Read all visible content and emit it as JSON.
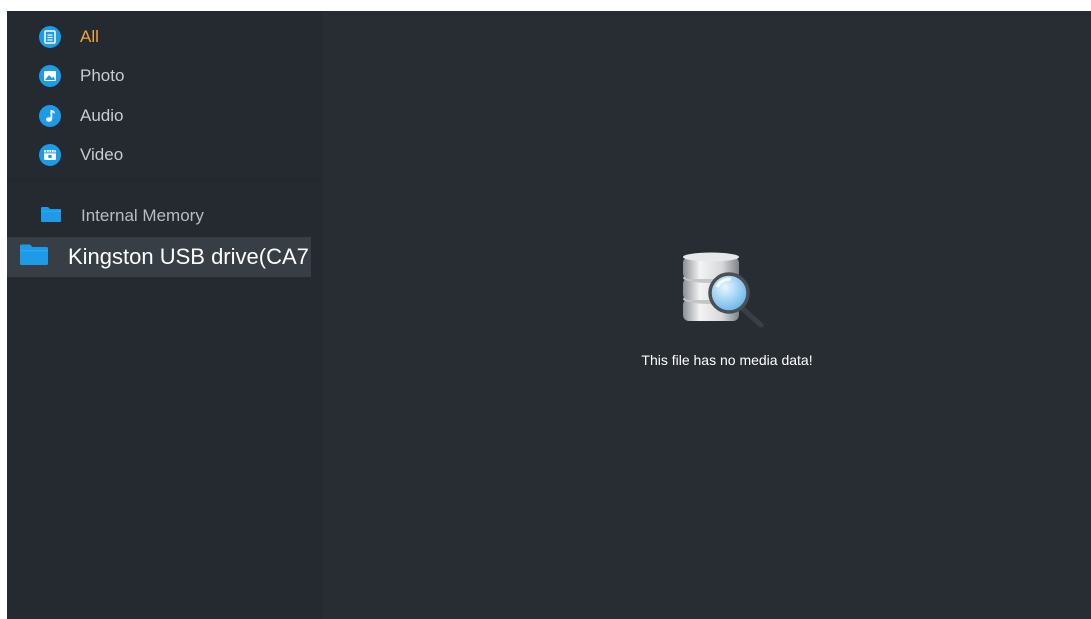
{
  "categories": [
    {
      "label": "All",
      "icon": "document-icon",
      "active": true
    },
    {
      "label": "Photo",
      "icon": "photo-icon",
      "active": false
    },
    {
      "label": "Audio",
      "icon": "music-note-icon",
      "active": false
    },
    {
      "label": "Video",
      "icon": "video-icon",
      "active": false
    }
  ],
  "devices": [
    {
      "label": "Internal Memory",
      "icon": "folder-icon"
    },
    {
      "label": "Kingston USB drive(CA7",
      "icon": "folder-icon",
      "selected": true
    }
  ],
  "main": {
    "empty_message": "This file has no media data!",
    "empty_icon": "database-search-icon"
  },
  "colors": {
    "background": "#272d33",
    "sidebar": "#242a30",
    "accent": "#f2a53a",
    "icon_blue": "#1e9be8",
    "selected_row": "#373e45"
  }
}
